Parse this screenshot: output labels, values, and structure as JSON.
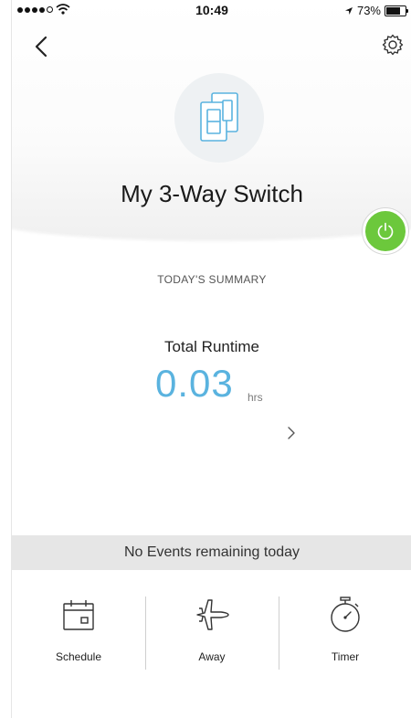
{
  "status_bar": {
    "time": "10:49",
    "battery_text": "73%",
    "battery_level": 0.73
  },
  "header": {
    "back_icon": "chevron-left-icon",
    "settings_icon": "gear-icon",
    "device_icon": "three-way-switch-icon",
    "device_name": "My 3-Way Switch",
    "power_icon": "power-icon",
    "power_color": "#6cc83c"
  },
  "summary": {
    "title": "TODAY'S SUMMARY",
    "runtime_label": "Total Runtime",
    "runtime_value": "0.03",
    "runtime_unit": "hrs",
    "value_color": "#5ab3df"
  },
  "events": {
    "text": "No Events remaining today"
  },
  "actions": [
    {
      "label": "Schedule",
      "icon": "calendar-icon"
    },
    {
      "label": "Away",
      "icon": "airplane-icon"
    },
    {
      "label": "Timer",
      "icon": "stopwatch-icon"
    }
  ]
}
